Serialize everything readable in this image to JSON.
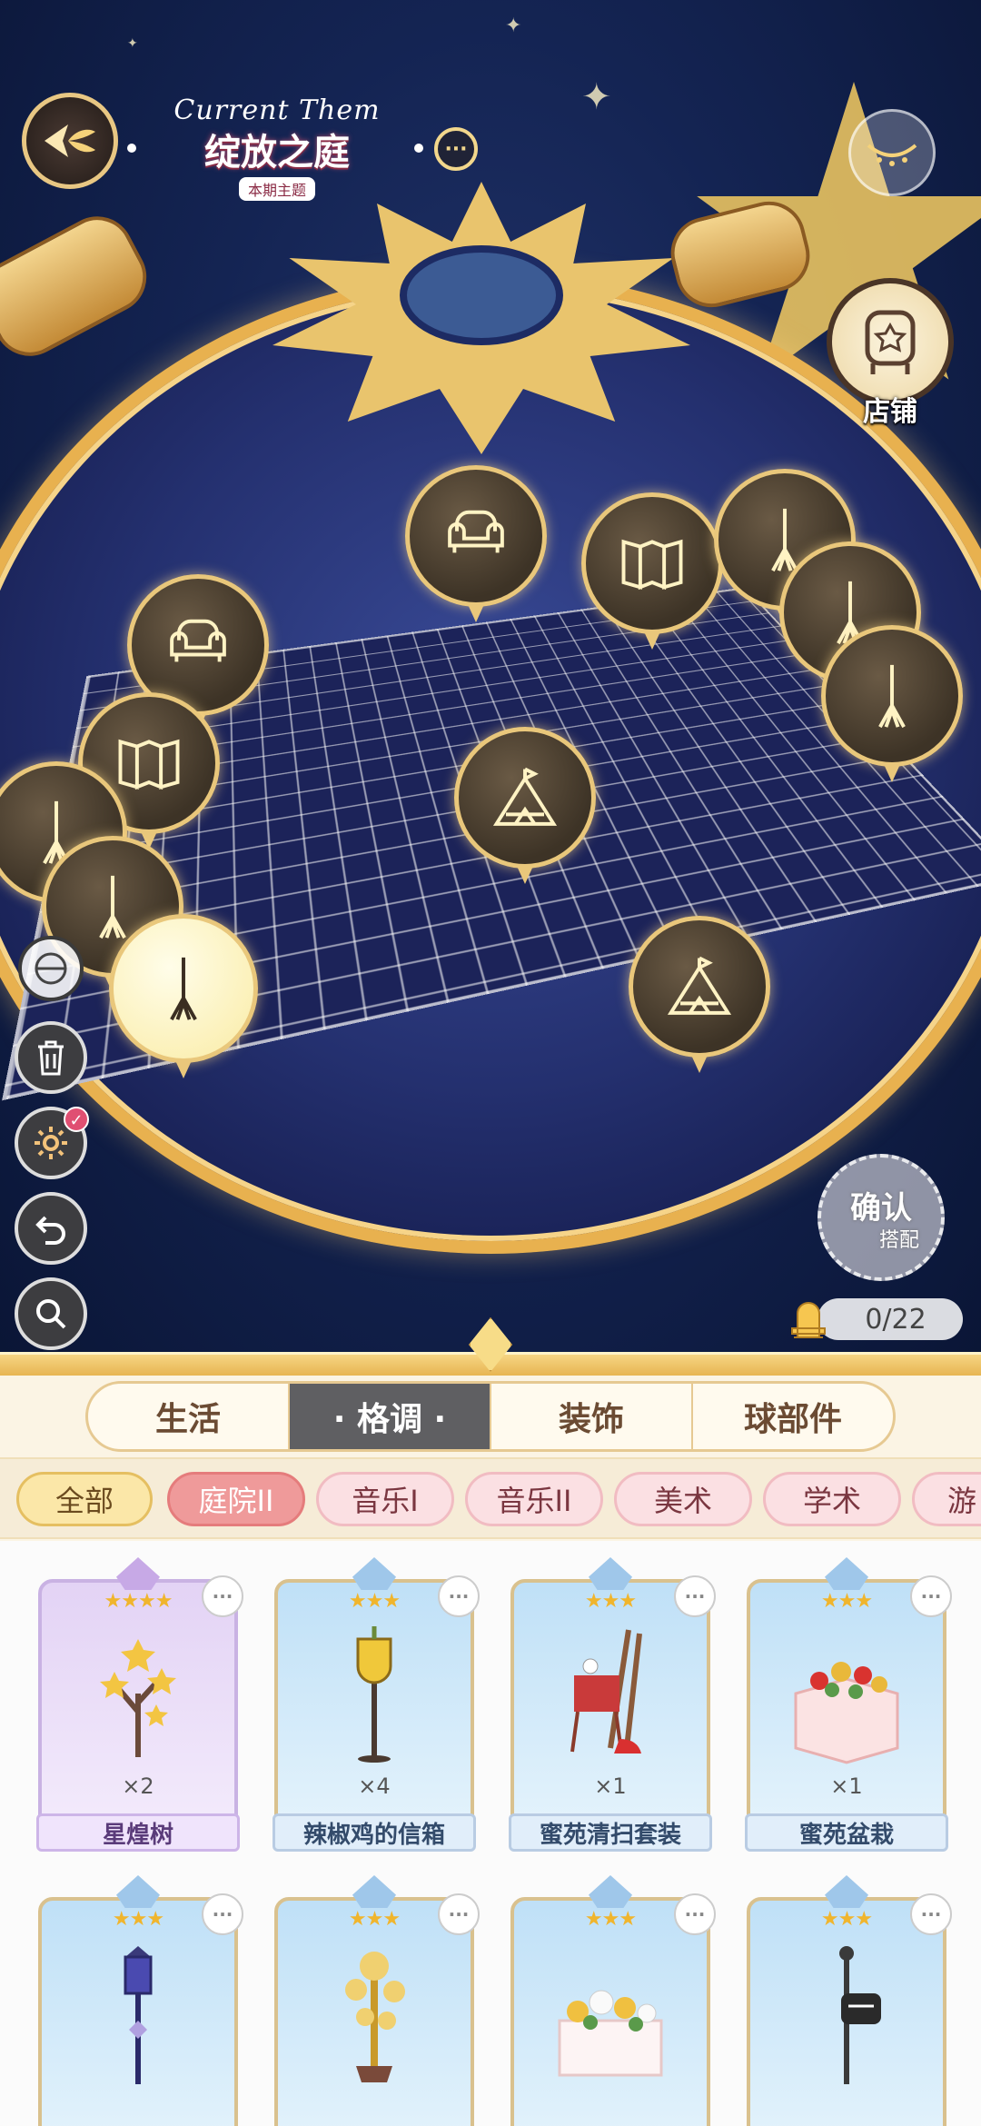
{
  "header": {
    "theme_eng": "Current Them",
    "theme_title": "绽放之庭",
    "theme_sub": "本期主题",
    "more_icon": "ellipsis-icon",
    "back_icon": "back-arrow-icon"
  },
  "shop": {
    "label": "店铺",
    "icon": "shop-sign-icon"
  },
  "scene": {
    "bubbles": [
      "sofa-icon",
      "screen-icon",
      "broom-icon",
      "tent-icon"
    ]
  },
  "tools": [
    "hide-icon",
    "trash-icon",
    "settings-icon",
    "undo-icon",
    "zoom-icon"
  ],
  "confirm": {
    "main": "确认",
    "sub": "搭配"
  },
  "capacity": {
    "value": "0/22",
    "icon": "throne-icon"
  },
  "category_tabs": [
    {
      "label": "生活",
      "active": false
    },
    {
      "label": "· 格调 ·",
      "active": true
    },
    {
      "label": "装饰",
      "active": false
    },
    {
      "label": "球部件",
      "active": false
    }
  ],
  "filters": [
    {
      "label": "全部"
    },
    {
      "label": "庭院II"
    },
    {
      "label": "音乐I"
    },
    {
      "label": "音乐II"
    },
    {
      "label": "美术"
    },
    {
      "label": "学术"
    },
    {
      "label": "游"
    }
  ],
  "items": [
    {
      "name": "星煌树",
      "qty": "×2",
      "stars": "★★★★",
      "rarity": "purple"
    },
    {
      "name": "辣椒鸡的信箱",
      "qty": "×4",
      "stars": "★★★",
      "rarity": "blue"
    },
    {
      "name": "蜜苑清扫套装",
      "qty": "×1",
      "stars": "★★★",
      "rarity": "blue"
    },
    {
      "name": "蜜苑盆栽",
      "qty": "×1",
      "stars": "★★★",
      "rarity": "blue"
    },
    {
      "name": "",
      "qty": "",
      "stars": "★★★",
      "rarity": "blue"
    },
    {
      "name": "",
      "qty": "",
      "stars": "★★★",
      "rarity": "blue"
    },
    {
      "name": "",
      "qty": "",
      "stars": "★★★",
      "rarity": "blue"
    },
    {
      "name": "",
      "qty": "",
      "stars": "★★★",
      "rarity": "blue"
    }
  ],
  "colors": {
    "gold": "#e8b14f",
    "night": "#142453",
    "selected_chip": "#ef9a9a",
    "active_tab": "#5f5f62"
  }
}
